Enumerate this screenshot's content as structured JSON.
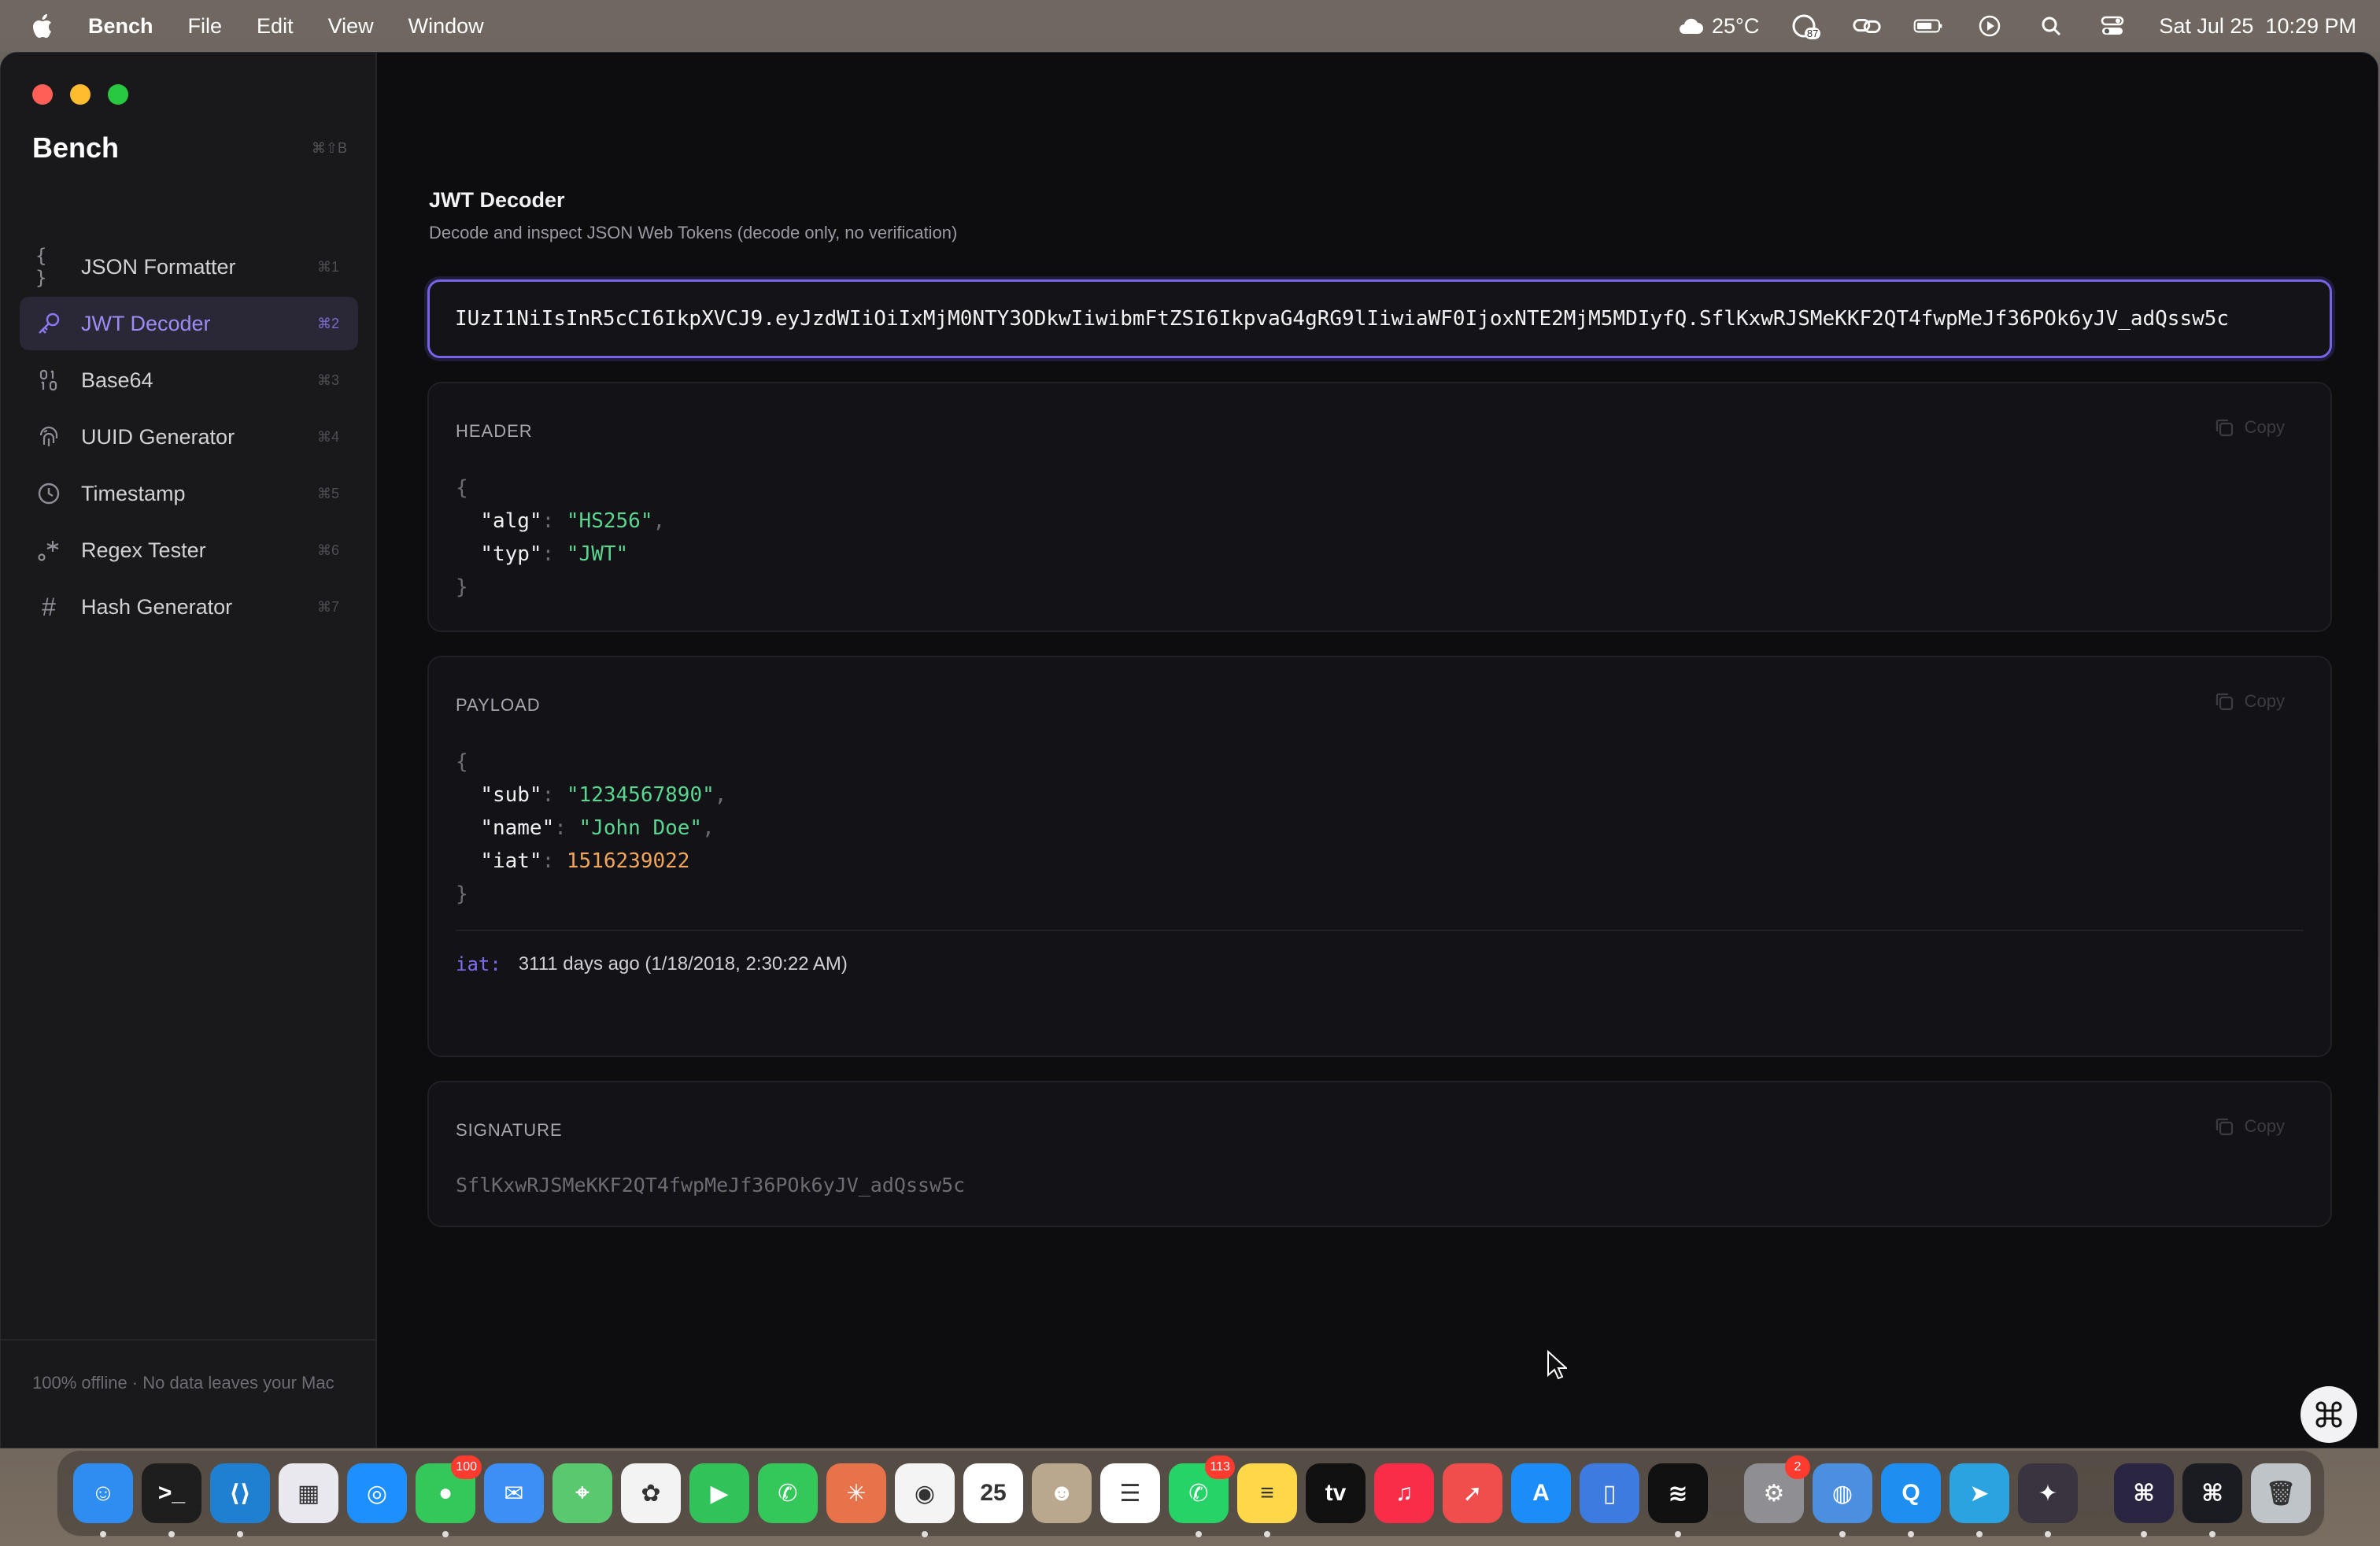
{
  "menubar": {
    "app_name": "Bench",
    "menus": [
      "File",
      "Edit",
      "View",
      "Window"
    ],
    "weather": "25°C",
    "datetime": "Sat Jul 25  10:29 PM",
    "status_badge": "87"
  },
  "sidebar": {
    "title": "Bench",
    "title_shortcut": "⌘⇧B",
    "items": [
      {
        "label": "JSON Formatter",
        "shortcut": "⌘1",
        "icon": "{ }",
        "active": false
      },
      {
        "label": "JWT Decoder",
        "shortcut": "⌘2",
        "icon": "key",
        "active": true
      },
      {
        "label": "Base64",
        "shortcut": "⌘3",
        "icon": "binary",
        "active": false
      },
      {
        "label": "UUID Generator",
        "shortcut": "⌘4",
        "icon": "fingerprint",
        "active": false
      },
      {
        "label": "Timestamp",
        "shortcut": "⌘5",
        "icon": "clock",
        "active": false
      },
      {
        "label": "Regex Tester",
        "shortcut": "⌘6",
        "icon": "regex",
        "active": false
      },
      {
        "label": "Hash Generator",
        "shortcut": "⌘7",
        "icon": "#",
        "active": false
      }
    ],
    "footer": "100% offline · No data leaves your Mac"
  },
  "main": {
    "title": "JWT Decoder",
    "subtitle": "Decode and inspect JSON Web Tokens (decode only, no verification)",
    "token_value": "IUzI1NiIsInR5cCI6IkpXVCJ9.eyJzdWIiOiIxMjM0NTY3ODkwIiwibmFtZSI6IkpvaG4gRG9lIiwiaWF0IjoxNTE2MjM5MDIyfQ.SflKxwRJSMeKKF2QT4fwpMeJf36POk6yJV_adQssw5c",
    "copy_label": "Copy",
    "header": {
      "title": "HEADER",
      "open": "{",
      "close": "}",
      "lines": [
        {
          "key": "\"alg\"",
          "value": "\"HS256\"",
          "type": "str",
          "comma": ","
        },
        {
          "key": "\"typ\"",
          "value": "\"JWT\"",
          "type": "str",
          "comma": ""
        }
      ]
    },
    "payload": {
      "title": "PAYLOAD",
      "open": "{",
      "close": "}",
      "lines": [
        {
          "key": "\"sub\"",
          "value": "\"1234567890\"",
          "type": "str",
          "comma": ","
        },
        {
          "key": "\"name\"",
          "value": "\"John Doe\"",
          "type": "str",
          "comma": ","
        },
        {
          "key": "\"iat\"",
          "value": "1516239022",
          "type": "num",
          "comma": ""
        }
      ],
      "iat_key": "iat:",
      "iat_text": "3111 days ago (1/18/2018, 2:30:22 AM)"
    },
    "signature": {
      "title": "SIGNATURE",
      "value": "SflKxwRJSMeKKF2QT4fwpMeJf36POk6yJV_adQssw5c"
    }
  },
  "dock": {
    "apps": [
      {
        "name": "Finder",
        "color": "#2f8cf0",
        "glyph": "☺",
        "badge": "",
        "running": true
      },
      {
        "name": "Terminal",
        "color": "#1e1e1e",
        "glyph": ">_",
        "badge": "",
        "running": true
      },
      {
        "name": "VS Code",
        "color": "#1f7fd0",
        "glyph": "⟨⟩",
        "badge": "",
        "running": true
      },
      {
        "name": "Launchpad",
        "color": "#e8e8ee",
        "glyph": "▦",
        "badge": "",
        "running": false
      },
      {
        "name": "Safari",
        "color": "#1e8fff",
        "glyph": "◎",
        "badge": "",
        "running": false
      },
      {
        "name": "Messages",
        "color": "#34c759",
        "glyph": "●",
        "badge": "100",
        "running": true
      },
      {
        "name": "Mail",
        "color": "#3b8ff5",
        "glyph": "✉",
        "badge": "",
        "running": false
      },
      {
        "name": "Maps",
        "color": "#5ac86e",
        "glyph": "⌖",
        "badge": "",
        "running": false
      },
      {
        "name": "Photos",
        "color": "#f3f3f3",
        "glyph": "✿",
        "badge": "",
        "running": false
      },
      {
        "name": "FaceTime",
        "color": "#32c25a",
        "glyph": "▶",
        "badge": "",
        "running": false
      },
      {
        "name": "Phone",
        "color": "#34c759",
        "glyph": "✆",
        "badge": "",
        "running": false
      },
      {
        "name": "Claude",
        "color": "#e8734a",
        "glyph": "✳",
        "badge": "",
        "running": false
      },
      {
        "name": "Chrome",
        "color": "#f4f4f4",
        "glyph": "◉",
        "badge": "",
        "running": true
      },
      {
        "name": "Calendar",
        "color": "#ffffff",
        "glyph": "25",
        "badge": "",
        "running": false
      },
      {
        "name": "Contacts",
        "color": "#b9a78e",
        "glyph": "☻",
        "badge": "",
        "running": false
      },
      {
        "name": "Reminders",
        "color": "#ffffff",
        "glyph": "☰",
        "badge": "",
        "running": false
      },
      {
        "name": "WhatsApp",
        "color": "#25d366",
        "glyph": "✆",
        "badge": "113",
        "running": true
      },
      {
        "name": "Notes",
        "color": "#ffd84a",
        "glyph": "≡",
        "badge": "",
        "running": true
      },
      {
        "name": "Apple TV",
        "color": "#111111",
        "glyph": "tv",
        "badge": "",
        "running": false
      },
      {
        "name": "Music",
        "color": "#fa2d48",
        "glyph": "♫",
        "badge": "",
        "running": false
      },
      {
        "name": "Rocket",
        "color": "#f04d4d",
        "glyph": "➚",
        "badge": "",
        "running": false
      },
      {
        "name": "App Store",
        "color": "#1c8cf8",
        "glyph": "A",
        "badge": "",
        "running": false
      },
      {
        "name": "Simulator",
        "color": "#3d7be0",
        "glyph": "▯",
        "badge": "",
        "running": false
      },
      {
        "name": "Spotify",
        "color": "#111111",
        "glyph": "≋",
        "badge": "",
        "running": true
      },
      {
        "name": "System Settings",
        "color": "#8e8e93",
        "glyph": "⚙",
        "badge": "2",
        "running": false
      },
      {
        "name": "Disk Utility",
        "color": "#4a8fe0",
        "glyph": "◍",
        "badge": "",
        "running": true
      },
      {
        "name": "Quick",
        "color": "#1f8ef1",
        "glyph": "Q",
        "badge": "",
        "running": true
      },
      {
        "name": "Telegram",
        "color": "#2aa3e0",
        "glyph": "➤",
        "badge": "",
        "running": true
      },
      {
        "name": "Game",
        "color": "#3a3440",
        "glyph": "✦",
        "badge": "",
        "running": true
      },
      {
        "name": "Shortcut",
        "color": "#2a2540",
        "glyph": "⌘",
        "badge": "",
        "running": true
      },
      {
        "name": "Bench",
        "color": "#1b1b22",
        "glyph": "⌘",
        "badge": "",
        "running": true
      },
      {
        "name": "Trash",
        "color": "#bfc4c8",
        "glyph": "🗑",
        "badge": "",
        "running": false
      }
    ]
  }
}
